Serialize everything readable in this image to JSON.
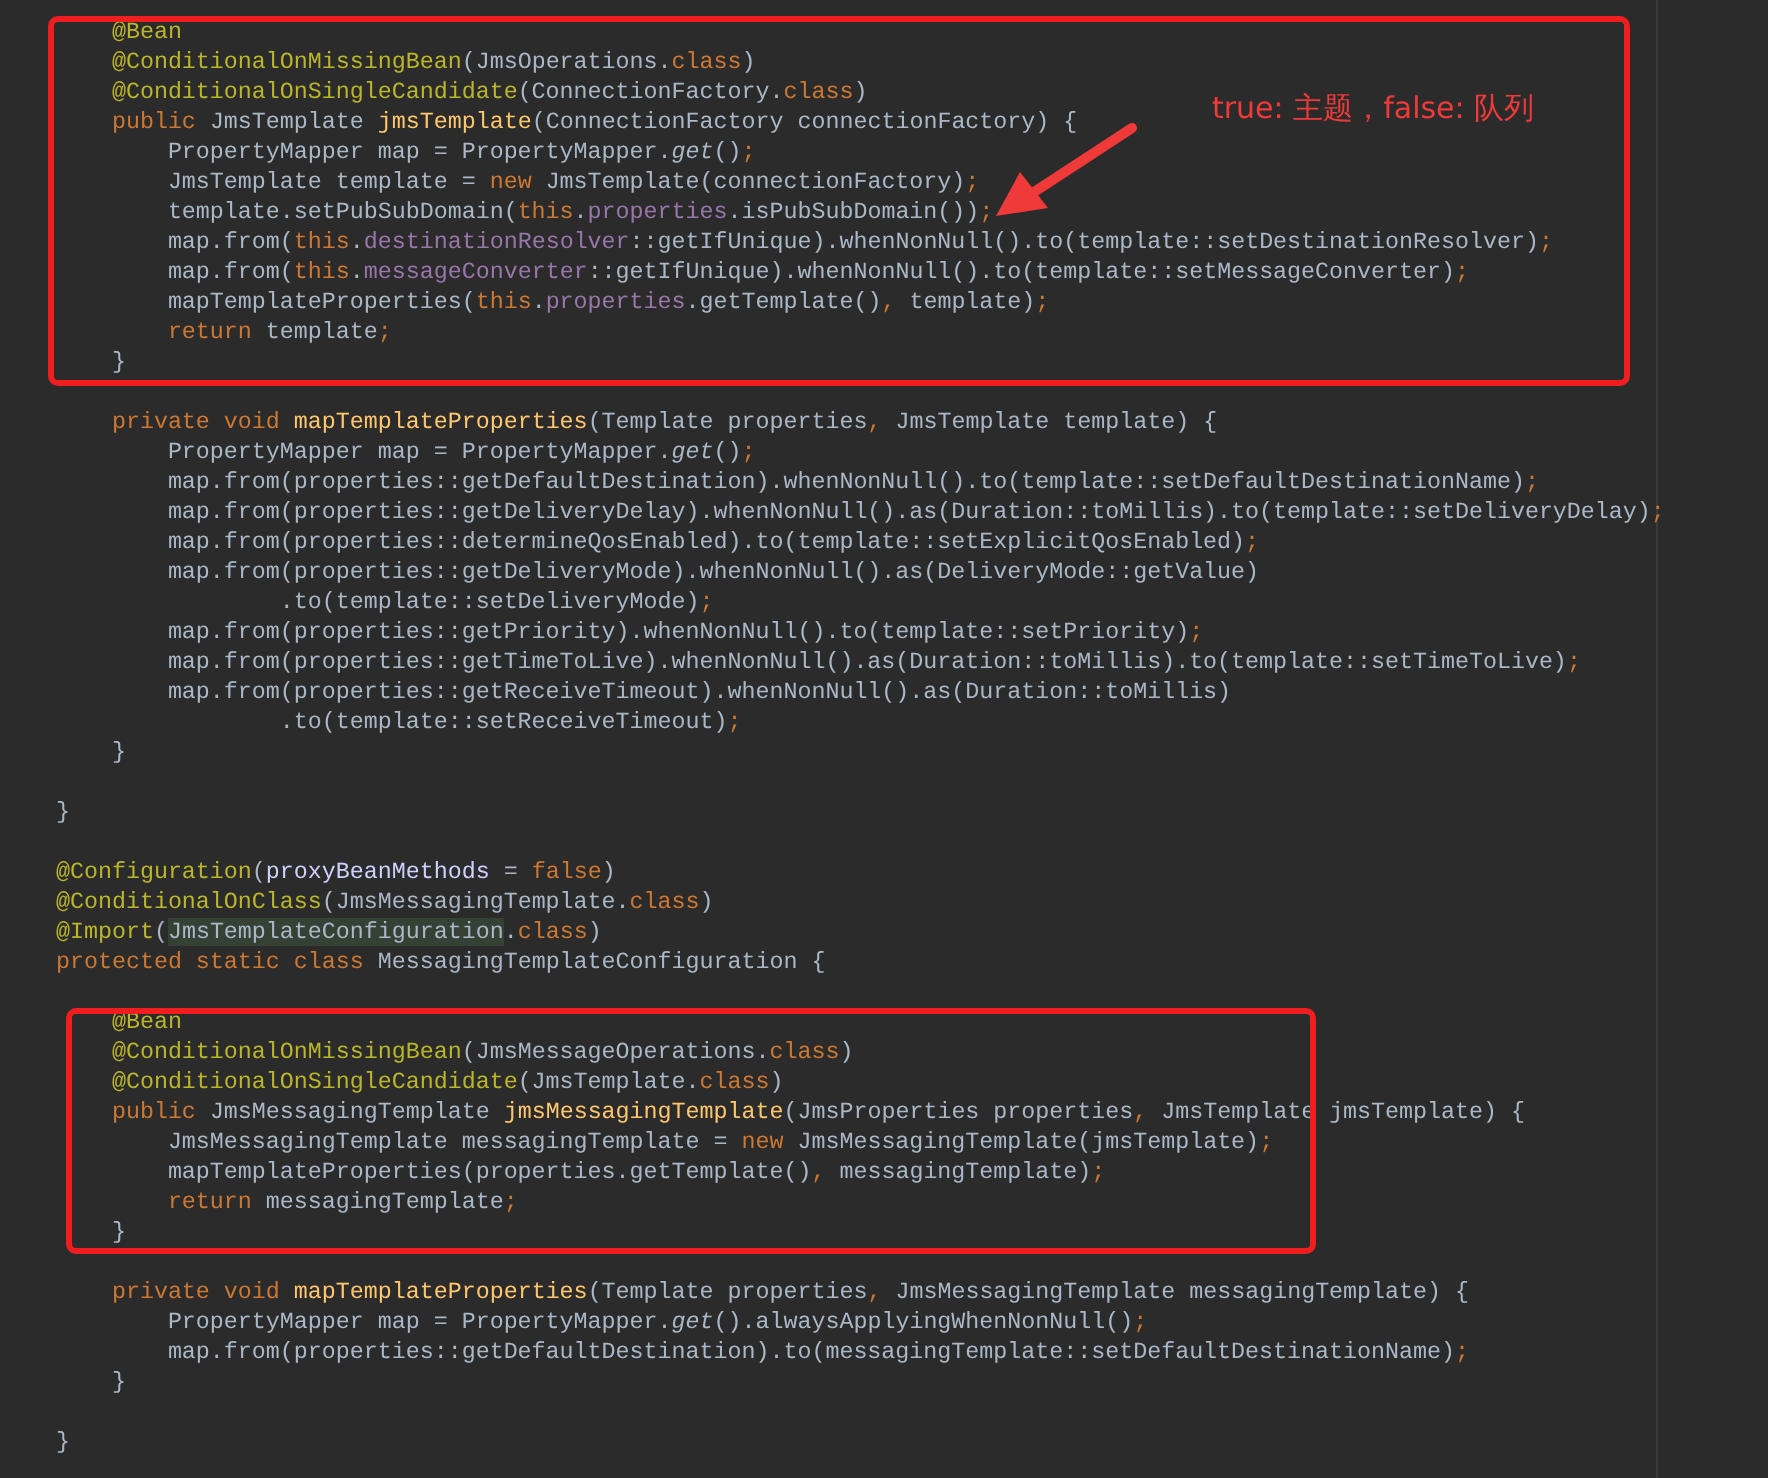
{
  "annotation": {
    "text": "true: 主题，false: 队列"
  },
  "code_blocks": [
    {
      "boxed": true,
      "lines": [
        [
          {
            "kind": "ann",
            "text": "        @Bean"
          }
        ],
        [
          {
            "kind": "ann",
            "text": "        @ConditionalOnMissingBean"
          },
          {
            "kind": "plain",
            "text": "(JmsOperations."
          },
          {
            "kind": "kw",
            "text": "class"
          },
          {
            "kind": "plain",
            "text": ")"
          }
        ],
        [
          {
            "kind": "ann",
            "text": "        @ConditionalOnSingleCandidate"
          },
          {
            "kind": "plain",
            "text": "(ConnectionFactory."
          },
          {
            "kind": "kw",
            "text": "class"
          },
          {
            "kind": "plain",
            "text": ")"
          }
        ],
        [
          {
            "kind": "kw",
            "text": "        public "
          },
          {
            "kind": "plain",
            "text": "JmsTemplate "
          },
          {
            "kind": "decl",
            "text": "jmsTemplate"
          },
          {
            "kind": "plain",
            "text": "(ConnectionFactory connectionFactory) {"
          }
        ],
        [
          {
            "kind": "plain",
            "text": "            PropertyMapper map = PropertyMapper."
          },
          {
            "kind": "static",
            "text": "get"
          },
          {
            "kind": "plain",
            "text": "()"
          },
          {
            "kind": "kw",
            "text": ";"
          }
        ],
        [
          {
            "kind": "plain",
            "text": "            JmsTemplate template = "
          },
          {
            "kind": "kw",
            "text": "new "
          },
          {
            "kind": "plain",
            "text": "JmsTemplate(connectionFactory)"
          },
          {
            "kind": "kw",
            "text": ";"
          }
        ],
        [
          {
            "kind": "plain",
            "text": "            template.setPubSubDomain("
          },
          {
            "kind": "kw",
            "text": "this"
          },
          {
            "kind": "plain",
            "text": "."
          },
          {
            "kind": "field",
            "text": "properties"
          },
          {
            "kind": "plain",
            "text": ".isPubSubDomain())"
          },
          {
            "kind": "kw",
            "text": ";"
          }
        ],
        [
          {
            "kind": "plain",
            "text": "            map.from("
          },
          {
            "kind": "kw",
            "text": "this"
          },
          {
            "kind": "plain",
            "text": "."
          },
          {
            "kind": "field",
            "text": "destinationResolver"
          },
          {
            "kind": "plain",
            "text": "::getIfUnique).whenNonNull().to(template::setDestinationResolver)"
          },
          {
            "kind": "kw",
            "text": ";"
          }
        ],
        [
          {
            "kind": "plain",
            "text": "            map.from("
          },
          {
            "kind": "kw",
            "text": "this"
          },
          {
            "kind": "plain",
            "text": "."
          },
          {
            "kind": "field",
            "text": "messageConverter"
          },
          {
            "kind": "plain",
            "text": "::getIfUnique).whenNonNull().to(template::setMessageConverter)"
          },
          {
            "kind": "kw",
            "text": ";"
          }
        ],
        [
          {
            "kind": "plain",
            "text": "            mapTemplateProperties("
          },
          {
            "kind": "kw",
            "text": "this"
          },
          {
            "kind": "plain",
            "text": "."
          },
          {
            "kind": "field",
            "text": "properties"
          },
          {
            "kind": "plain",
            "text": ".getTemplate()"
          },
          {
            "kind": "kw",
            "text": ", "
          },
          {
            "kind": "plain",
            "text": "template)"
          },
          {
            "kind": "kw",
            "text": ";"
          }
        ],
        [
          {
            "kind": "kw",
            "text": "            return "
          },
          {
            "kind": "plain",
            "text": "template"
          },
          {
            "kind": "kw",
            "text": ";"
          }
        ],
        [
          {
            "kind": "plain",
            "text": "        }"
          }
        ]
      ]
    },
    {
      "boxed": false,
      "lines": [
        [
          {
            "kind": "kw",
            "text": "        private void "
          },
          {
            "kind": "decl",
            "text": "mapTemplateProperties"
          },
          {
            "kind": "plain",
            "text": "(Template properties"
          },
          {
            "kind": "kw",
            "text": ", "
          },
          {
            "kind": "plain",
            "text": "JmsTemplate template) {"
          }
        ],
        [
          {
            "kind": "plain",
            "text": "            PropertyMapper map = PropertyMapper."
          },
          {
            "kind": "static",
            "text": "get"
          },
          {
            "kind": "plain",
            "text": "()"
          },
          {
            "kind": "kw",
            "text": ";"
          }
        ],
        [
          {
            "kind": "plain",
            "text": "            map.from(properties::getDefaultDestination).whenNonNull().to(template::setDefaultDestinationName)"
          },
          {
            "kind": "kw",
            "text": ";"
          }
        ],
        [
          {
            "kind": "plain",
            "text": "            map.from(properties::getDeliveryDelay).whenNonNull().as(Duration::toMillis).to(template::setDeliveryDelay)"
          },
          {
            "kind": "kw",
            "text": ";"
          }
        ],
        [
          {
            "kind": "plain",
            "text": "            map.from(properties::determineQosEnabled).to(template::setExplicitQosEnabled)"
          },
          {
            "kind": "kw",
            "text": ";"
          }
        ],
        [
          {
            "kind": "plain",
            "text": "            map.from(properties::getDeliveryMode).whenNonNull().as(DeliveryMode::getValue)"
          }
        ],
        [
          {
            "kind": "plain",
            "text": "                    .to(template::setDeliveryMode)"
          },
          {
            "kind": "kw",
            "text": ";"
          }
        ],
        [
          {
            "kind": "plain",
            "text": "            map.from(properties::getPriority).whenNonNull().to(template::setPriority)"
          },
          {
            "kind": "kw",
            "text": ";"
          }
        ],
        [
          {
            "kind": "plain",
            "text": "            map.from(properties::getTimeToLive).whenNonNull().as(Duration::toMillis).to(template::setTimeToLive)"
          },
          {
            "kind": "kw",
            "text": ";"
          }
        ],
        [
          {
            "kind": "plain",
            "text": "            map.from(properties::getReceiveTimeout).whenNonNull().as(Duration::toMillis)"
          }
        ],
        [
          {
            "kind": "plain",
            "text": "                    .to(template::setReceiveTimeout)"
          },
          {
            "kind": "kw",
            "text": ";"
          }
        ],
        [
          {
            "kind": "plain",
            "text": "        }"
          }
        ]
      ]
    },
    {
      "boxed": false,
      "lines": [
        [
          {
            "kind": "plain",
            "text": "    }"
          }
        ]
      ]
    },
    {
      "boxed": false,
      "lines": [
        [
          {
            "kind": "ann",
            "text": "    @Configuration"
          },
          {
            "kind": "plain",
            "text": "("
          },
          {
            "kind": "param",
            "text": "proxyBeanMethods"
          },
          {
            "kind": "plain",
            "text": " = "
          },
          {
            "kind": "kw",
            "text": "false"
          },
          {
            "kind": "plain",
            "text": ")"
          }
        ],
        [
          {
            "kind": "ann",
            "text": "    @ConditionalOnClass"
          },
          {
            "kind": "plain",
            "text": "(JmsMessagingTemplate."
          },
          {
            "kind": "kw",
            "text": "class"
          },
          {
            "kind": "plain",
            "text": ")"
          }
        ],
        [
          {
            "kind": "ann",
            "text": "    @Import"
          },
          {
            "kind": "plain",
            "text": "("
          },
          {
            "kind": "mark",
            "text": "JmsTemplateConfiguration"
          },
          {
            "kind": "plain",
            "text": "."
          },
          {
            "kind": "kw",
            "text": "class"
          },
          {
            "kind": "plain",
            "text": ")"
          }
        ],
        [
          {
            "kind": "kw",
            "text": "    protected static class "
          },
          {
            "kind": "plain",
            "text": "MessagingTemplateConfiguration {"
          }
        ]
      ]
    },
    {
      "boxed": true,
      "lines": [
        [
          {
            "kind": "ann",
            "text": "        @Bean"
          }
        ],
        [
          {
            "kind": "ann",
            "text": "        @ConditionalOnMissingBean"
          },
          {
            "kind": "plain",
            "text": "(JmsMessageOperations."
          },
          {
            "kind": "kw",
            "text": "class"
          },
          {
            "kind": "plain",
            "text": ")"
          }
        ],
        [
          {
            "kind": "ann",
            "text": "        @ConditionalOnSingleCandidate"
          },
          {
            "kind": "plain",
            "text": "(JmsTemplate."
          },
          {
            "kind": "kw",
            "text": "class"
          },
          {
            "kind": "plain",
            "text": ")"
          }
        ],
        [
          {
            "kind": "kw",
            "text": "        public "
          },
          {
            "kind": "plain",
            "text": "JmsMessagingTemplate "
          },
          {
            "kind": "decl",
            "text": "jmsMessagingTemplate"
          },
          {
            "kind": "plain",
            "text": "(JmsProperties properties"
          },
          {
            "kind": "kw",
            "text": ", "
          },
          {
            "kind": "plain",
            "text": "JmsTemplate jmsTemplate) {"
          }
        ],
        [
          {
            "kind": "plain",
            "text": "            JmsMessagingTemplate messagingTemplate = "
          },
          {
            "kind": "kw",
            "text": "new "
          },
          {
            "kind": "plain",
            "text": "JmsMessagingTemplate(jmsTemplate)"
          },
          {
            "kind": "kw",
            "text": ";"
          }
        ],
        [
          {
            "kind": "plain",
            "text": "            mapTemplateProperties(properties.getTemplate()"
          },
          {
            "kind": "kw",
            "text": ", "
          },
          {
            "kind": "plain",
            "text": "messagingTemplate)"
          },
          {
            "kind": "kw",
            "text": ";"
          }
        ],
        [
          {
            "kind": "kw",
            "text": "            return "
          },
          {
            "kind": "plain",
            "text": "messagingTemplate"
          },
          {
            "kind": "kw",
            "text": ";"
          }
        ],
        [
          {
            "kind": "plain",
            "text": "        }"
          }
        ]
      ]
    },
    {
      "boxed": false,
      "lines": [
        [
          {
            "kind": "kw",
            "text": "        private void "
          },
          {
            "kind": "decl",
            "text": "mapTemplateProperties"
          },
          {
            "kind": "plain",
            "text": "(Template properties"
          },
          {
            "kind": "kw",
            "text": ", "
          },
          {
            "kind": "plain",
            "text": "JmsMessagingTemplate messagingTemplate) {"
          }
        ],
        [
          {
            "kind": "plain",
            "text": "            PropertyMapper map = PropertyMapper."
          },
          {
            "kind": "static",
            "text": "get"
          },
          {
            "kind": "plain",
            "text": "().alwaysApplyingWhenNonNull()"
          },
          {
            "kind": "kw",
            "text": ";"
          }
        ],
        [
          {
            "kind": "plain",
            "text": "            map.from(properties::getDefaultDestination).to(messagingTemplate::setDefaultDestinationName)"
          },
          {
            "kind": "kw",
            "text": ";"
          }
        ],
        [
          {
            "kind": "plain",
            "text": "        }"
          }
        ]
      ]
    },
    {
      "boxed": false,
      "lines": [
        [
          {
            "kind": "plain",
            "text": "    }"
          }
        ]
      ]
    }
  ]
}
